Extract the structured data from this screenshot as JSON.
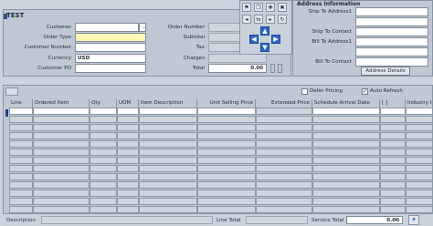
{
  "header": {
    "title": "TEST",
    "customer_label": "Customer",
    "order_type_label": "Order Type",
    "customer_number_label": "Customer Number",
    "currency_label": "Currency",
    "currency_value": "USD",
    "customer_po_label": "Customer PO",
    "order_number_label": "Order Number",
    "subtotal_label": "Subtotal",
    "tax_label": "Tax",
    "charges_label": "Charges",
    "total_label": "Total",
    "total_value": "0.00"
  },
  "address": {
    "title": "Address Information",
    "ship_to_address_label": "Ship To Address1",
    "ship_to_contact_label": "Ship To Contact",
    "bill_to_address_label": "Bill To Address1",
    "bill_to_contact_label": "Bill To Contact",
    "details_button": "Address Details"
  },
  "options": {
    "defer_pricing": "Defer Pricing",
    "auto_refresh": "Auto Refresh"
  },
  "grid": {
    "columns": [
      "Line",
      "Ordered Item",
      "Qty",
      "UOM",
      "Item Description",
      "Unit Selling Price",
      "Extended Price",
      "Schedule Arrival Date",
      "[ ]",
      "Industry In"
    ]
  },
  "footer": {
    "description_label": "Description",
    "line_total_label": "Line Total",
    "service_total_label": "Service Total",
    "service_total_value": "0.00"
  },
  "colors": {
    "required": "#fff6b8",
    "accent_blue": "#2a67c8"
  }
}
